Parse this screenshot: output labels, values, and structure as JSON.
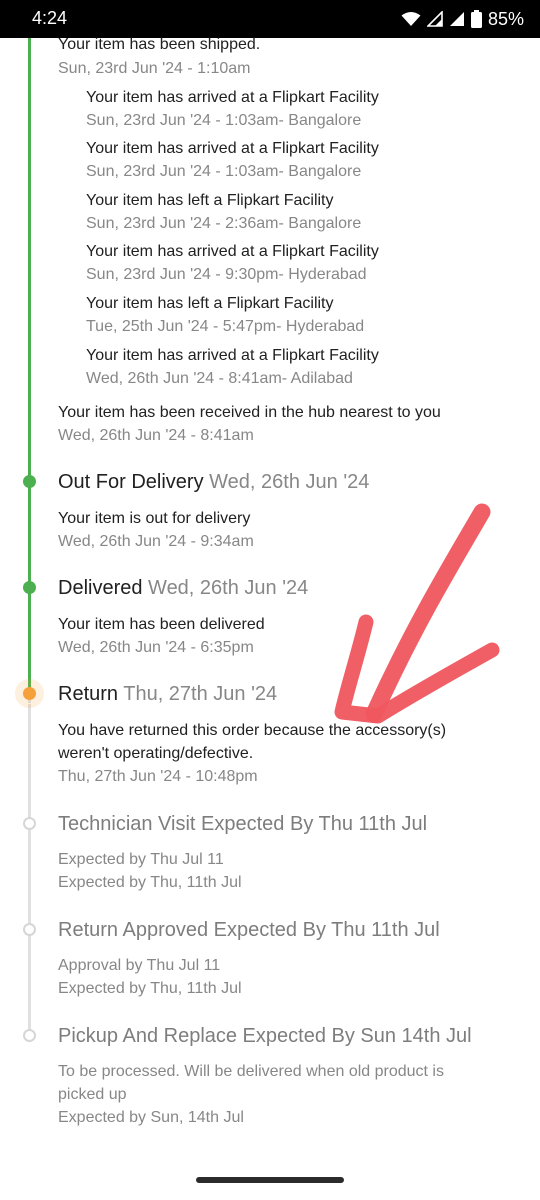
{
  "status_bar": {
    "time": "4:24",
    "battery": "85%"
  },
  "timeline": {
    "shipped": {
      "title": "Your item has been shipped.",
      "time": "Sun, 23rd Jun '24 - 1:10am"
    },
    "hops": [
      {
        "title": "Your item has arrived at a Flipkart Facility",
        "time": "Sun, 23rd Jun '24 - 1:03am- Bangalore"
      },
      {
        "title": "Your item has arrived at a Flipkart Facility",
        "time": "Sun, 23rd Jun '24 - 1:03am- Bangalore"
      },
      {
        "title": "Your item has left a Flipkart Facility",
        "time": "Sun, 23rd Jun '24 - 2:36am- Bangalore"
      },
      {
        "title": "Your item has arrived at a Flipkart Facility",
        "time": "Sun, 23rd Jun '24 - 9:30pm- Hyderabad"
      },
      {
        "title": "Your item has left a Flipkart Facility",
        "time": "Tue, 25th Jun '24 - 5:47pm- Hyderabad"
      },
      {
        "title": "Your item has arrived at a Flipkart Facility",
        "time": "Wed, 26th Jun '24 - 8:41am- Adilabad"
      }
    ],
    "hub": {
      "title": "Your item has been received in the hub nearest to you",
      "time": "Wed, 26th Jun '24 - 8:41am"
    },
    "out_for_delivery": {
      "label": "Out For Delivery",
      "date": "Wed, 26th Jun '24",
      "event": "Your item is out for delivery",
      "time": "Wed, 26th Jun '24 - 9:34am"
    },
    "delivered": {
      "label": "Delivered",
      "date": "Wed, 26th Jun '24",
      "event": "Your item has been delivered",
      "time": "Wed, 26th Jun '24 - 6:35pm"
    },
    "return": {
      "label": "Return",
      "date": "Thu, 27th Jun '24",
      "event_line1": "You have returned this order because the accessory(s)",
      "event_line2": "weren't operating/defective.",
      "time": "Thu, 27th Jun '24 - 10:48pm"
    },
    "technician_visit": {
      "label": "Technician Visit Expected By Thu 11th Jul",
      "line1": "Expected by Thu Jul 11",
      "line2": "Expected by Thu, 11th Jul"
    },
    "return_approved": {
      "label": "Return Approved Expected By Thu 11th Jul",
      "line1": "Approval by Thu Jul 11",
      "line2": "Expected by Thu, 11th Jul"
    },
    "pickup_replace": {
      "label": "Pickup And Replace Expected By Sun 14th Jul",
      "line1": "To be processed. Will be delivered when old product is",
      "line2": "picked up",
      "line3": "Expected by Sun, 14th Jul"
    }
  },
  "colors": {
    "completed": "#4caf50",
    "current": "#f5a03b",
    "pending": "#d6d6d6",
    "annotation": "#f0565e",
    "text": "#212121",
    "muted": "#878787"
  }
}
